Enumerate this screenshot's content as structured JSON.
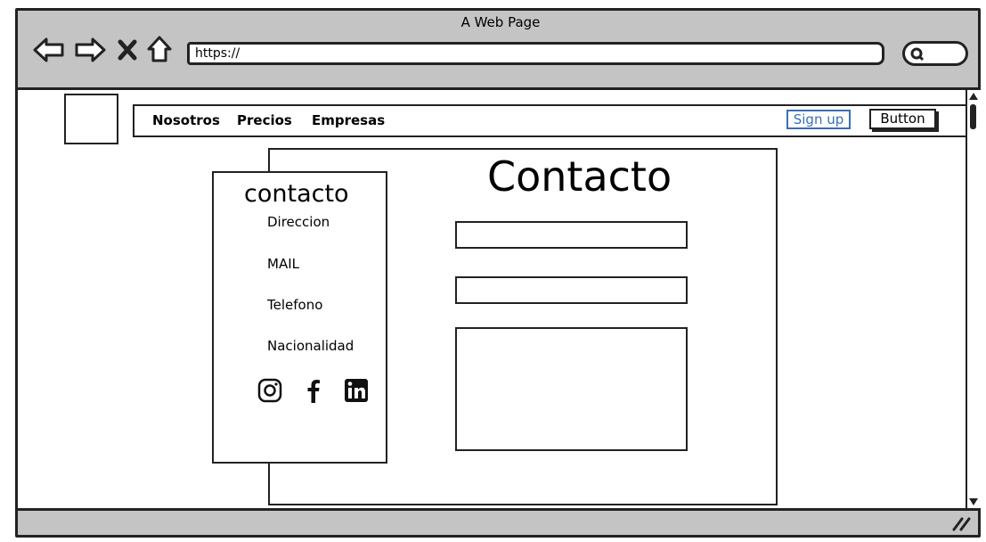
{
  "window": {
    "title": "A Web Page",
    "url": "https://"
  },
  "nav": {
    "links": [
      "Nosotros",
      "Precios",
      "Empresas"
    ],
    "signup_label": "Sign up",
    "button_label": "Button",
    "signup_color": "#3b6fb6"
  },
  "main": {
    "heading": "Contacto"
  },
  "card": {
    "title": "contacto",
    "items": [
      "Direccion",
      "MAIL",
      "Telefono",
      "Nacionalidad"
    ],
    "social_icons": [
      "instagram-icon",
      "facebook-icon",
      "linkedin-icon"
    ]
  },
  "icons": {
    "toolbar": [
      "back-arrow-icon",
      "forward-arrow-icon",
      "close-icon",
      "home-icon"
    ],
    "search": "search-icon",
    "resize": "resize-grip-icon"
  }
}
